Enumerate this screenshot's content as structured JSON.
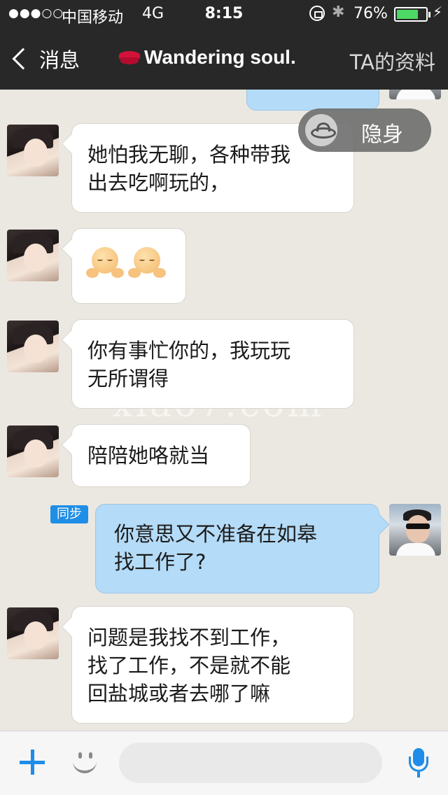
{
  "status_bar": {
    "signal": "●●●○○",
    "carrier": "中国移动",
    "network": "4G",
    "time": "8:15",
    "bluetooth_icon": "✱",
    "battery_percent": "76%",
    "battery_level": 0.76,
    "charging_icon": "⚡"
  },
  "nav": {
    "back_label": "消息",
    "title": "Wandering soul.",
    "profile_label": "TA的资料",
    "title_icon": "lips-icon"
  },
  "stealth_pill": {
    "label": "隐身"
  },
  "watermark": "xiao7.com",
  "messages": [
    {
      "side": "in",
      "text": "她怕我无聊，各种带我\n出去吃啊玩的，"
    },
    {
      "side": "in",
      "text": "",
      "emoji": [
        "smiling-hug-emoji",
        "smiling-hug-emoji"
      ]
    },
    {
      "side": "in",
      "text": "你有事忙你的，我玩玩\n无所谓得"
    },
    {
      "side": "in",
      "text": "陪陪她咯就当"
    },
    {
      "side": "out",
      "text": "你意思又不准备在如皋\n找工作了?",
      "badge": "同步"
    },
    {
      "side": "in",
      "text": "问题是我找不到工作，\n找了工作，不是就不能\n回盐城或者去哪了嘛"
    }
  ],
  "input_bar": {
    "add_icon": "plus-icon",
    "emoji_icon": "smiley-icon",
    "mic_icon": "microphone-icon",
    "placeholder": ""
  },
  "colors": {
    "bar_background": "#282828",
    "chat_background": "#ebe8e1",
    "incoming_bubble": "#ffffff",
    "outgoing_bubble": "#b4dbf7",
    "accent": "#1e8ce8",
    "battery_fill": "#4cd964"
  }
}
